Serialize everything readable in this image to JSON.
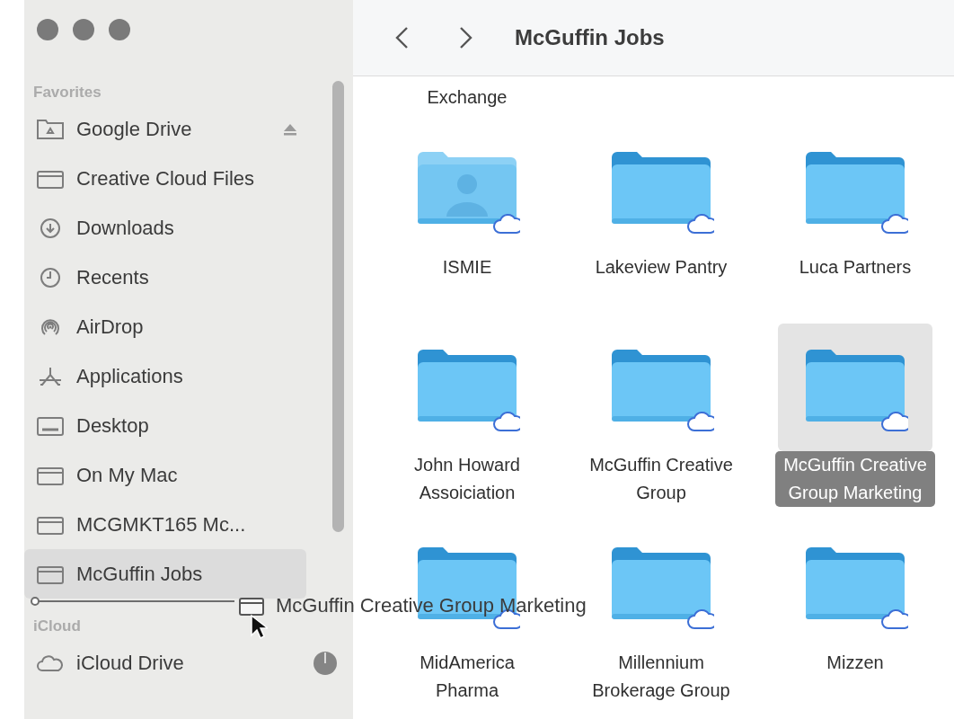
{
  "window": {
    "title": "McGuffin Jobs"
  },
  "sidebar": {
    "sections": [
      {
        "title": "Favorites",
        "items": [
          {
            "label": "Google Drive",
            "kind": "drive",
            "eject": true,
            "selected": false
          },
          {
            "label": "Creative Cloud Files",
            "kind": "folder",
            "selected": false
          },
          {
            "label": "Downloads",
            "kind": "download",
            "selected": false
          },
          {
            "label": "Recents",
            "kind": "clock",
            "selected": false
          },
          {
            "label": "AirDrop",
            "kind": "airdrop",
            "selected": false
          },
          {
            "label": "Applications",
            "kind": "apps",
            "selected": false
          },
          {
            "label": "Desktop",
            "kind": "desktop",
            "selected": false
          },
          {
            "label": "On My Mac",
            "kind": "folder",
            "selected": false
          },
          {
            "label": "MCGMKT165 Mc...",
            "kind": "folder",
            "selected": false
          },
          {
            "label": "McGuffin Jobs",
            "kind": "folder",
            "selected": true
          }
        ]
      },
      {
        "title": "iCloud",
        "items": [
          {
            "label": "iCloud Drive",
            "kind": "cloud",
            "selected": false,
            "syncing": true
          }
        ]
      }
    ]
  },
  "cut_labels": [
    "Exchange"
  ],
  "folders": [
    {
      "label": "ISMIE",
      "kind": "shared",
      "selected": false
    },
    {
      "label": "Lakeview Pantry",
      "kind": "plain",
      "selected": false
    },
    {
      "label": "Luca Partners",
      "kind": "plain",
      "selected": false
    },
    {
      "label": "John Howard Assoiciation",
      "kind": "plain",
      "selected": false
    },
    {
      "label": "McGuffin Creative Group",
      "kind": "plain",
      "selected": false
    },
    {
      "label": "McGuffin Creative Group Marketing",
      "kind": "plain",
      "selected": true
    },
    {
      "label": "MidAmerica Pharma",
      "kind": "plain",
      "selected": false
    },
    {
      "label": "Millennium Brokerage Group",
      "kind": "plain",
      "selected": false
    },
    {
      "label": "Mizzen",
      "kind": "plain",
      "selected": false
    }
  ],
  "drag": {
    "label": "McGuffin Creative Group Marketing"
  }
}
